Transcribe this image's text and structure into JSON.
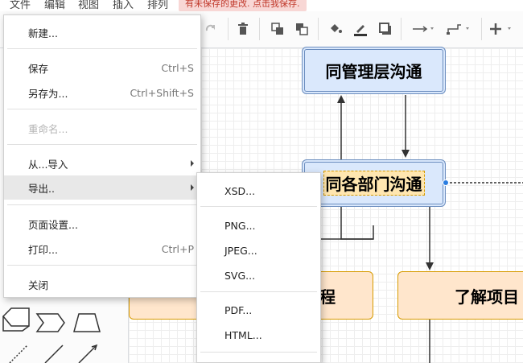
{
  "menubar": {
    "items": [
      "文件",
      "编辑",
      "视图",
      "插入",
      "排列"
    ],
    "unsaved_notice": "有未保存的更改. 点击我保存."
  },
  "toolbar": {
    "icons": [
      "redo-icon",
      "delete-icon",
      "to-front-icon",
      "to-back-icon",
      "fill-color-icon",
      "line-color-icon",
      "shadow-icon",
      "connection-icon",
      "waypoints-icon",
      "insert-icon"
    ]
  },
  "diagram": {
    "node_top": "同管理层沟通",
    "node_mid": "同各部门沟通",
    "node_left": "了解流程",
    "node_left_visible": "程",
    "node_right": "了解项目",
    "colors": {
      "blue_fill": "#dae8fc",
      "blue_stroke": "#6c8ebf",
      "orange_fill": "#ffe6cc",
      "orange_stroke": "#d79b00"
    }
  },
  "file_menu": {
    "new": "新建...",
    "save": "保存",
    "save_shortcut": "Ctrl+S",
    "save_as": "另存为...",
    "save_as_shortcut": "Ctrl+Shift+S",
    "rename": "重命名...",
    "import_from": "从...导入",
    "export_as": "导出..",
    "page_setup": "页面设置...",
    "print": "打印...",
    "print_shortcut": "Ctrl+P",
    "close": "关闭"
  },
  "export_submenu": {
    "items": [
      "XSD...",
      "PNG...",
      "JPEG...",
      "SVG...",
      "PDF...",
      "HTML..."
    ]
  }
}
